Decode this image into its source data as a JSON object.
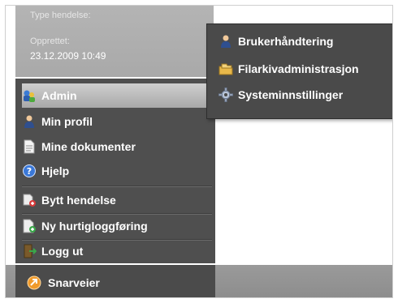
{
  "info": {
    "type_label": "Type hendelse:",
    "created_label": "Opprettet:",
    "created_value": "23.12.2009 10:49"
  },
  "menu": {
    "items": [
      {
        "label": "Admin",
        "icon": "admin-icon"
      },
      {
        "label": "Min profil",
        "icon": "user-icon"
      },
      {
        "label": "Mine dokumenter",
        "icon": "document-icon"
      },
      {
        "label": "Hjelp",
        "icon": "help-icon"
      },
      {
        "label": "Bytt hendelse",
        "icon": "switch-event-icon"
      },
      {
        "label": "Ny hurtigloggføring",
        "icon": "quick-log-icon"
      },
      {
        "label": "Logg ut",
        "icon": "logout-icon"
      }
    ],
    "shortcuts_label": "Snarveier"
  },
  "submenu": {
    "items": [
      {
        "label": "Brukerhåndtering",
        "icon": "user-management-icon"
      },
      {
        "label": "Filarkivadministrasjon",
        "icon": "file-archive-icon"
      },
      {
        "label": "Systeminnstillinger",
        "icon": "gear-icon"
      }
    ]
  },
  "colors": {
    "menu_bg": "#4f4f4f",
    "active_item": "#bdbdbd",
    "info_panel": "#afafaf"
  }
}
